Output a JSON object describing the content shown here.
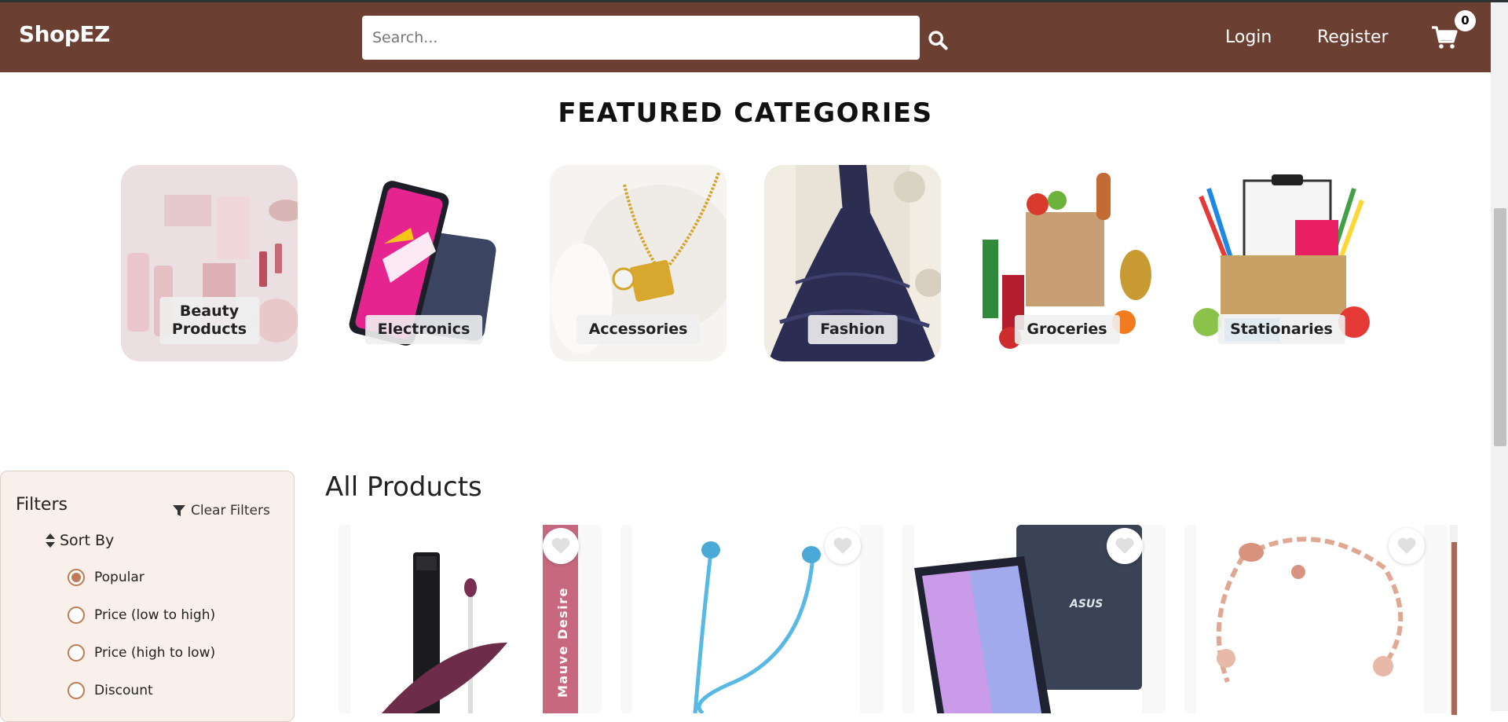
{
  "header": {
    "brand": "ShopEZ",
    "search_placeholder": "Search...",
    "login_label": "Login",
    "register_label": "Register",
    "cart_count": "0",
    "search_icon": "search-icon",
    "cart_icon": "cart-icon"
  },
  "featured": {
    "title": "FEATURED CATEGORIES",
    "categories": [
      {
        "label": "Beauty\nProducts"
      },
      {
        "label": "Electronics"
      },
      {
        "label": "Accessories"
      },
      {
        "label": "Fashion"
      },
      {
        "label": "Groceries"
      },
      {
        "label": "Stationaries"
      }
    ]
  },
  "filters": {
    "title": "Filters",
    "clear_label": "Clear Filters",
    "sort_by_label": "Sort By",
    "sort_options": [
      {
        "label": "Popular",
        "checked": true
      },
      {
        "label": "Price (low to high)",
        "checked": false
      },
      {
        "label": "Price (high to low)",
        "checked": false
      },
      {
        "label": "Discount",
        "checked": false
      }
    ]
  },
  "products": {
    "title": "All Products",
    "banner_text": "Mauve Desire",
    "laptop_brand": "ASUS"
  },
  "colors": {
    "navbar": "#6b3f31",
    "accent": "#c07a55",
    "filter_bg": "#faf0eb"
  }
}
